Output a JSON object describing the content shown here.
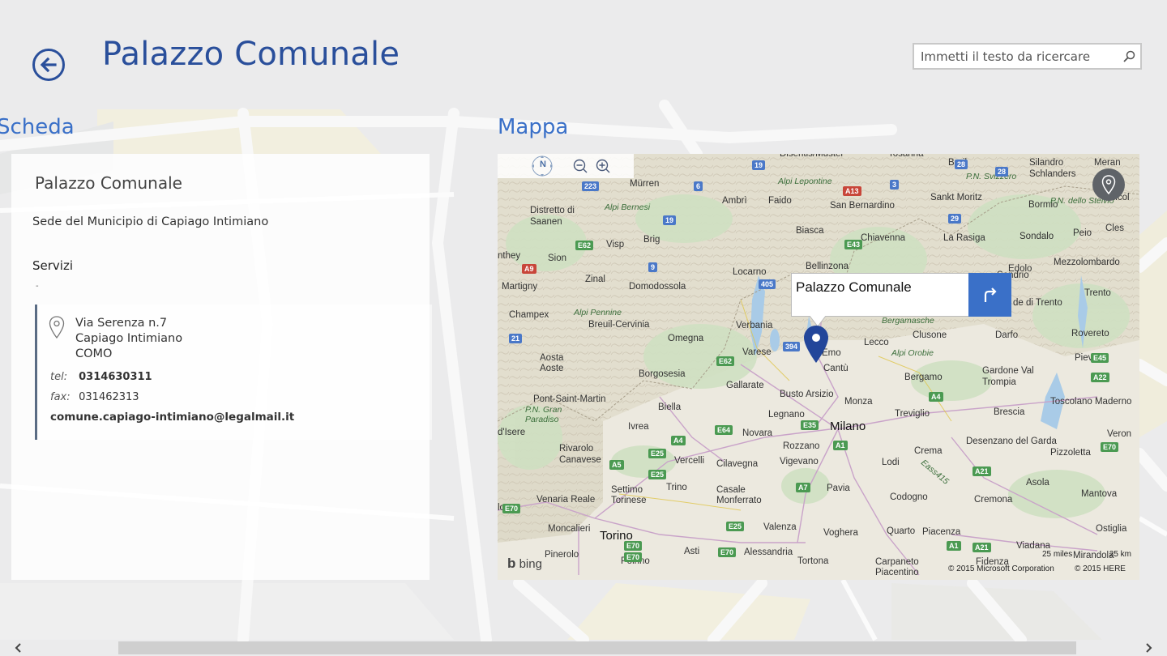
{
  "header": {
    "title": "Palazzo Comunale",
    "search_placeholder": "Immetti il testo da ricercare"
  },
  "sections": {
    "scheda_label": "Scheda",
    "mappa_label": "Mappa"
  },
  "card": {
    "title": "Palazzo Comunale",
    "subtitle": "Sede del Municipio di Capiago Intimiano",
    "services_label": "Servizi",
    "services_value": "-",
    "address": {
      "street": "Via Serenza n.7",
      "city": "Capiago Intimiano",
      "province": "COMO"
    },
    "tel_label": "tel:",
    "tel_value": "0314630311",
    "fax_label": "fax:",
    "fax_value": "031462313",
    "email": "comune.capiago-intimiano@legalmail.it"
  },
  "map": {
    "popup_title": "Palazzo Comunale",
    "compass_label": "N",
    "bing_label": "bing",
    "copyright_ms": "© 2015 Microsoft Corporation",
    "copyright_here": "© 2015 HERE",
    "scale_miles": "25 miles",
    "scale_km": "25 km",
    "labels": [
      {
        "t": "Disentis/Mustér",
        "c": "ml-s"
      },
      {
        "t": "Tosanna",
        "c": "ml-s"
      },
      {
        "t": "Brail",
        "c": "ml-s"
      },
      {
        "t": "P.N. Svizzero",
        "c": "ml-i"
      },
      {
        "t": "Silandro",
        "c": "ml-s"
      },
      {
        "t": "Schlanders",
        "c": "ml-s"
      },
      {
        "t": "Meran",
        "c": "ml-s"
      },
      {
        "t": "Mürren",
        "c": "ml-s"
      },
      {
        "t": "Alpi Lepontine",
        "c": "ml-i"
      },
      {
        "t": "Ambrì",
        "c": "ml-s"
      },
      {
        "t": "Faido",
        "c": "ml-s"
      },
      {
        "t": "San Bernardino",
        "c": "ml-s"
      },
      {
        "t": "Sankt Moritz",
        "c": "ml-s"
      },
      {
        "t": "Bormio",
        "c": "ml-s"
      },
      {
        "t": "P.N. dello Stelvio",
        "c": "ml-i"
      },
      {
        "t": "Nicol",
        "c": "ml-s"
      },
      {
        "t": "Distretto di",
        "c": "ml-s"
      },
      {
        "t": "Saanen",
        "c": "ml-s"
      },
      {
        "t": "Alpi Bernesi",
        "c": "ml-i"
      },
      {
        "t": "Biasca",
        "c": "ml-s"
      },
      {
        "t": "Chiavenna",
        "c": "ml-s"
      },
      {
        "t": "La Rasiga",
        "c": "ml-s"
      },
      {
        "t": "Sondalo",
        "c": "ml-s"
      },
      {
        "t": "Peio",
        "c": "ml-s"
      },
      {
        "t": "Cles",
        "c": "ml-s"
      },
      {
        "t": "Visp",
        "c": "ml-s"
      },
      {
        "t": "Brig",
        "c": "ml-s"
      },
      {
        "t": "Sion",
        "c": "ml-s"
      },
      {
        "t": "Bellinzona",
        "c": "ml-s"
      },
      {
        "t": "Mezzolombardo",
        "c": "ml-s"
      },
      {
        "t": "Zinal",
        "c": "ml-s"
      },
      {
        "t": "Locarno",
        "c": "ml-s"
      },
      {
        "t": "Edolo",
        "c": "ml-s"
      },
      {
        "t": "Martigny",
        "c": "ml-s"
      },
      {
        "t": "Domodossola",
        "c": "ml-s"
      },
      {
        "t": "Trento",
        "c": "ml-s"
      },
      {
        "t": "Alpi Pennine",
        "c": "ml-i"
      },
      {
        "t": "Champex",
        "c": "ml-s"
      },
      {
        "t": "Bergamasche",
        "c": "ml-i"
      },
      {
        "t": "Breuil-Cervinia",
        "c": "ml-s"
      },
      {
        "t": "Verbania",
        "c": "ml-s"
      },
      {
        "t": "Lecco",
        "c": "ml-s"
      },
      {
        "t": "Clusone",
        "c": "ml-s"
      },
      {
        "t": "Darfo",
        "c": "ml-s"
      },
      {
        "t": "Rovereto",
        "c": "ml-s"
      },
      {
        "t": "Omegna",
        "c": "ml-s"
      },
      {
        "t": "Aosta",
        "c": "ml-s"
      },
      {
        "t": "Aoste",
        "c": "ml-s"
      },
      {
        "t": "Varese",
        "c": "ml-s"
      },
      {
        "t": "Alpi Orobie",
        "c": "ml-i"
      },
      {
        "t": "Pieve",
        "c": "ml-s"
      },
      {
        "t": "Cantù",
        "c": "ml-s"
      },
      {
        "t": "Borgosesia",
        "c": "ml-s"
      },
      {
        "t": "Bergamo",
        "c": "ml-s"
      },
      {
        "t": "Gardone Val",
        "c": "ml-s"
      },
      {
        "t": "Trompia",
        "c": "ml-s"
      },
      {
        "t": "Gallarate",
        "c": "ml-s"
      },
      {
        "t": "Pont-Saint-Martin",
        "c": "ml-s"
      },
      {
        "t": "Busto Arsizio",
        "c": "ml-s"
      },
      {
        "t": "Monza",
        "c": "ml-s"
      },
      {
        "t": "Toscolano Maderno",
        "c": "ml-s"
      },
      {
        "t": "Biella",
        "c": "ml-s"
      },
      {
        "t": "P.N. Gran",
        "c": "ml-i"
      },
      {
        "t": "Paradiso",
        "c": "ml-i"
      },
      {
        "t": "Legnano",
        "c": "ml-s"
      },
      {
        "t": "Treviglio",
        "c": "ml-s"
      },
      {
        "t": "Brescia",
        "c": "ml-s"
      },
      {
        "t": "Milano",
        "c": "ml-l"
      },
      {
        "t": "d'Isere",
        "c": "ml-s"
      },
      {
        "t": "Ivrea",
        "c": "ml-s"
      },
      {
        "t": "Novara",
        "c": "ml-s"
      },
      {
        "t": "Veron",
        "c": "ml-s"
      },
      {
        "t": "Rozzano",
        "c": "ml-s"
      },
      {
        "t": "Desenzano del Garda",
        "c": "ml-s"
      },
      {
        "t": "Rivarolo",
        "c": "ml-s"
      },
      {
        "t": "Canavese",
        "c": "ml-s"
      },
      {
        "t": "Crema",
        "c": "ml-s"
      },
      {
        "t": "Pizzoletta",
        "c": "ml-s"
      },
      {
        "t": "Vercelli",
        "c": "ml-s"
      },
      {
        "t": "Cilavegna",
        "c": "ml-s"
      },
      {
        "t": "Vigevano",
        "c": "ml-s"
      },
      {
        "t": "Lodi",
        "c": "ml-s"
      },
      {
        "t": "Settimo",
        "c": "ml-s"
      },
      {
        "t": "Torinese",
        "c": "ml-s"
      },
      {
        "t": "Trino",
        "c": "ml-s"
      },
      {
        "t": "Pavia",
        "c": "ml-s"
      },
      {
        "t": "Casale",
        "c": "ml-s"
      },
      {
        "t": "Monferrato",
        "c": "ml-s"
      },
      {
        "t": "Asola",
        "c": "ml-s"
      },
      {
        "t": "Venaria Reale",
        "c": "ml-s"
      },
      {
        "t": "Codogno",
        "c": "ml-s"
      },
      {
        "t": "Cremona",
        "c": "ml-s"
      },
      {
        "t": "Mantova",
        "c": "ml-s"
      },
      {
        "t": "Moncalieri",
        "c": "ml-s"
      },
      {
        "t": "Torino",
        "c": "ml-l"
      },
      {
        "t": "Valenza",
        "c": "ml-s"
      },
      {
        "t": "Voghera",
        "c": "ml-s"
      },
      {
        "t": "Quarto",
        "c": "ml-s"
      },
      {
        "t": "Piacenza",
        "c": "ml-s"
      },
      {
        "t": "Ostiglia",
        "c": "ml-s"
      },
      {
        "t": "Pinerolo",
        "c": "ml-s"
      },
      {
        "t": "Asti",
        "c": "ml-s"
      },
      {
        "t": "Alessandria",
        "c": "ml-s"
      },
      {
        "t": "Poirino",
        "c": "ml-s"
      },
      {
        "t": "Tortona",
        "c": "ml-s"
      },
      {
        "t": "Carpaneto",
        "c": "ml-s"
      },
      {
        "t": "Piacentino",
        "c": "ml-s"
      },
      {
        "t": "Fidenza",
        "c": "ml-s"
      },
      {
        "t": "Mirandola",
        "c": "ml-s"
      },
      {
        "t": "Viadana",
        "c": "ml-s"
      },
      {
        "t": "lonne",
        "c": "ml-s"
      },
      {
        "t": "nthey",
        "c": "ml-s"
      },
      {
        "t": "Emo",
        "c": "ml-s"
      },
      {
        "t": "de di Trento",
        "c": "ml-s"
      },
      {
        "t": "Sondrio",
        "c": "ml-s"
      },
      {
        "t": "Eass415",
        "c": "ml-i"
      }
    ],
    "shields": [
      {
        "t": "28",
        "c": "sh-blue"
      },
      {
        "t": "19",
        "c": "sh-blue"
      },
      {
        "t": "223",
        "c": "sh-blue"
      },
      {
        "t": "6",
        "c": "sh-blue"
      },
      {
        "t": "A13",
        "c": "sh-red"
      },
      {
        "t": "3",
        "c": "sh-blue"
      },
      {
        "t": "19",
        "c": "sh-blue"
      },
      {
        "t": "29",
        "c": "sh-blue"
      },
      {
        "t": "E62",
        "c": "sh-green"
      },
      {
        "t": "E43",
        "c": "sh-green"
      },
      {
        "t": "9",
        "c": "sh-blue"
      },
      {
        "t": "A9",
        "c": "sh-red"
      },
      {
        "t": "405",
        "c": "sh-blue"
      },
      {
        "t": "21",
        "c": "sh-blue"
      },
      {
        "t": "394",
        "c": "sh-blue"
      },
      {
        "t": "E62",
        "c": "sh-green"
      },
      {
        "t": "E45",
        "c": "sh-green"
      },
      {
        "t": "A22",
        "c": "sh-green"
      },
      {
        "t": "A4",
        "c": "sh-green"
      },
      {
        "t": "E35",
        "c": "sh-green"
      },
      {
        "t": "E64",
        "c": "sh-green"
      },
      {
        "t": "A4",
        "c": "sh-green"
      },
      {
        "t": "A1",
        "c": "sh-green"
      },
      {
        "t": "E25",
        "c": "sh-green"
      },
      {
        "t": "A5",
        "c": "sh-green"
      },
      {
        "t": "E25",
        "c": "sh-green"
      },
      {
        "t": "A7",
        "c": "sh-green"
      },
      {
        "t": "A21",
        "c": "sh-green"
      },
      {
        "t": "E70",
        "c": "sh-green"
      },
      {
        "t": "E70",
        "c": "sh-green"
      },
      {
        "t": "E25",
        "c": "sh-green"
      },
      {
        "t": "E70",
        "c": "sh-green"
      },
      {
        "t": "E70",
        "c": "sh-green"
      },
      {
        "t": "A1",
        "c": "sh-green"
      },
      {
        "t": "A21",
        "c": "sh-green"
      },
      {
        "t": "E70",
        "c": "sh-green"
      },
      {
        "t": "28",
        "c": "sh-blue"
      }
    ]
  }
}
